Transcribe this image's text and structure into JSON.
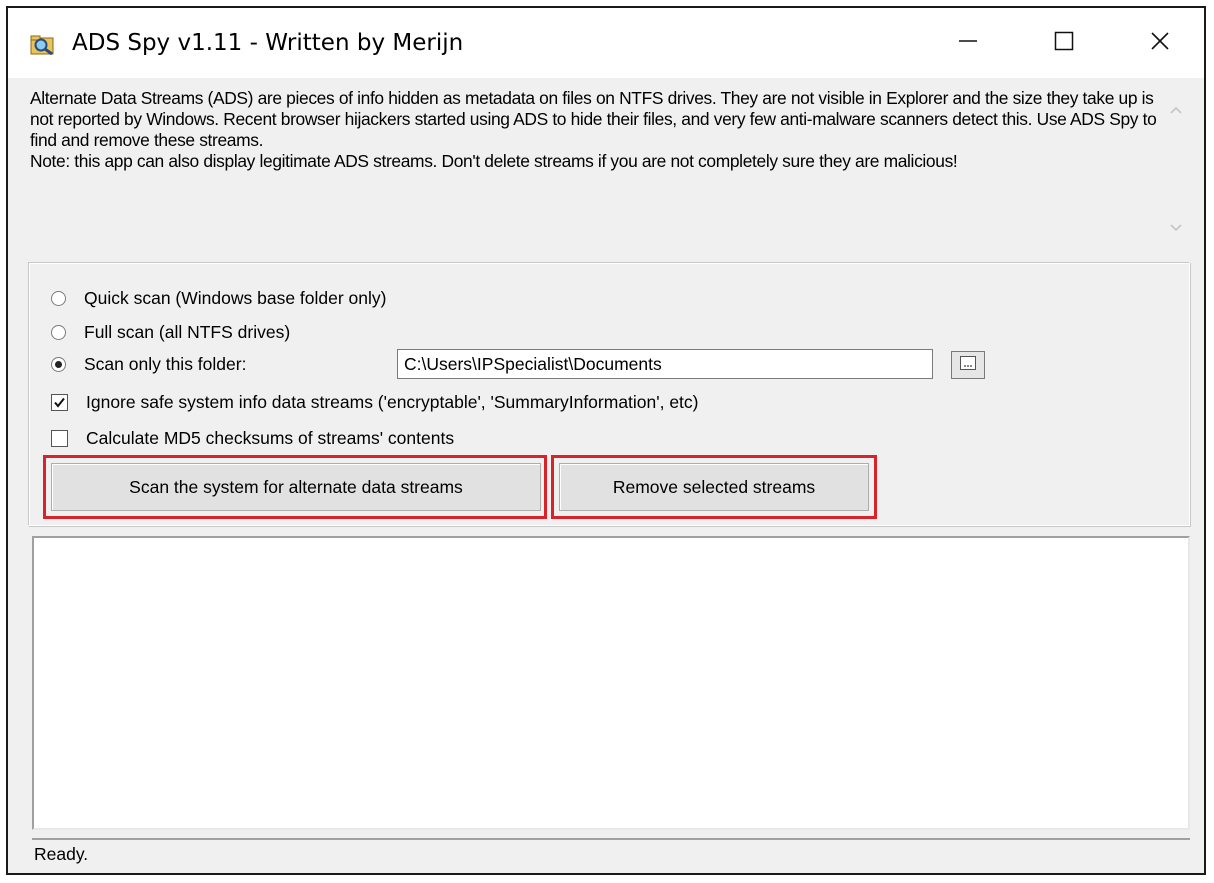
{
  "window": {
    "title": "ADS Spy v1.11 - Written by Merijn",
    "icon": "magnifier-folder-icon",
    "controls": [
      "minimize-icon",
      "maximize-icon",
      "close-icon"
    ]
  },
  "info": {
    "text": "Alternate Data Streams (ADS) are pieces of info hidden as metadata on files on NTFS drives. They are not visible in Explorer and the size they take up is not reported by Windows. Recent browser hijackers started using ADS to hide their files, and very few anti-malware scanners detect this. Use ADS Spy to find and remove these streams.\nNote: this app can also display legitimate ADS streams. Don't delete streams if you are not completely sure they are malicious!"
  },
  "options": {
    "quick_scan": "Quick scan (Windows base folder only)",
    "full_scan": "Full scan (all NTFS drives)",
    "folder_scan": "Scan only this folder:",
    "folder_path": "C:\\Users\\IPSpecialist\\Documents",
    "selected": "folder_scan",
    "ignore_safe": "Ignore safe system info data streams ('encryptable', 'SummaryInformation', etc)",
    "ignore_safe_checked": true,
    "md5": "Calculate MD5 checksums of streams' contents",
    "md5_checked": false
  },
  "buttons": {
    "scan": "Scan the system for alternate data streams",
    "remove": "Remove selected streams"
  },
  "status": {
    "text": "Ready."
  },
  "colors": {
    "highlight": "#d8232a",
    "window_bg": "#f0f0f0"
  }
}
